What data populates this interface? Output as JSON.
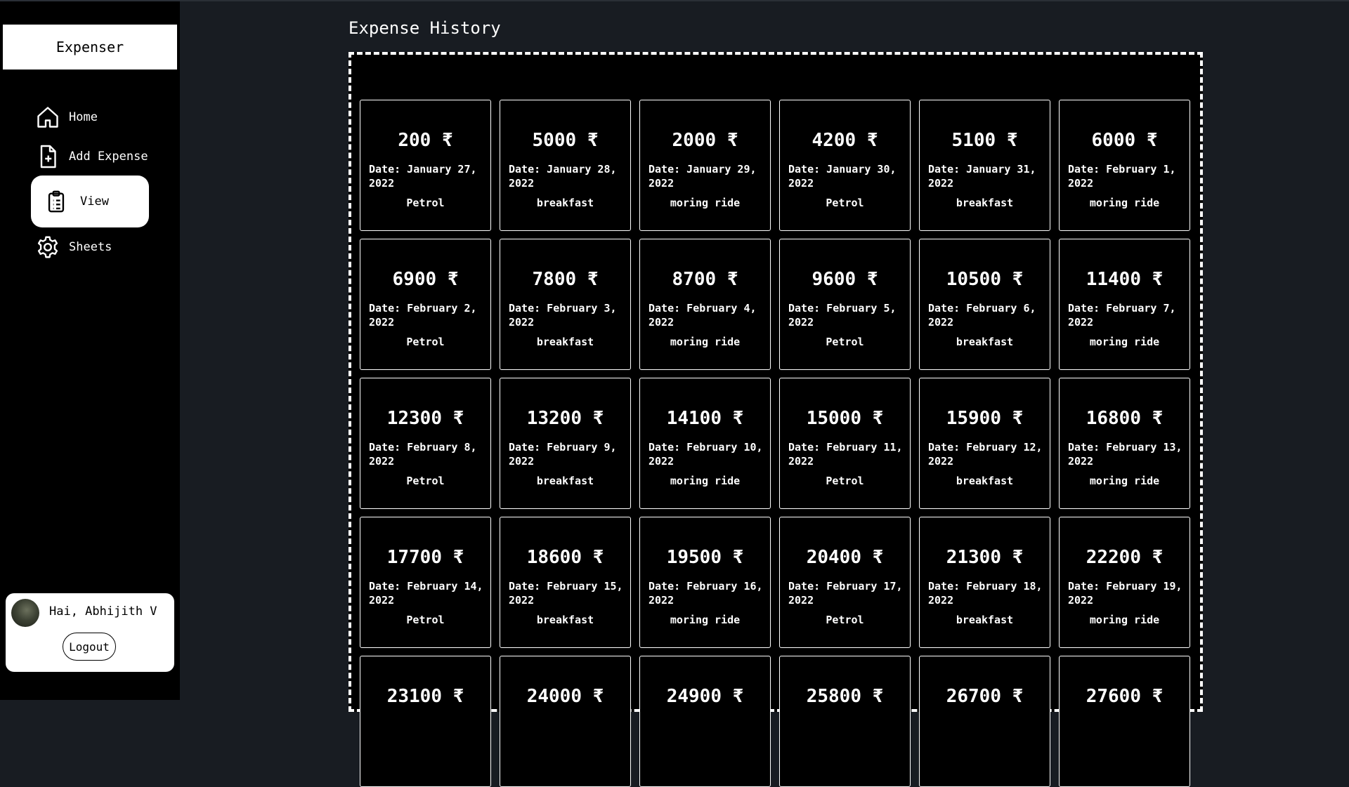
{
  "sidebar": {
    "brand": "Expenser",
    "items": [
      {
        "label": "Home",
        "icon": "home-icon"
      },
      {
        "label": "Add Expense",
        "icon": "add-file-icon"
      },
      {
        "label": "View",
        "icon": "clipboard-icon"
      },
      {
        "label": "Sheets",
        "icon": "gear-icon"
      }
    ],
    "active": "View",
    "user": {
      "greeting": "Hai, Abhijith V",
      "logout_label": "Logout"
    }
  },
  "main": {
    "title": "Expense History",
    "currency": "₹",
    "expenses": [
      {
        "amount": "200",
        "date": "Date: January 27, 2022",
        "desc": "Petrol"
      },
      {
        "amount": "5000",
        "date": "Date: January 28, 2022",
        "desc": "breakfast"
      },
      {
        "amount": "2000",
        "date": "Date: January 29, 2022",
        "desc": "moring ride"
      },
      {
        "amount": "4200",
        "date": "Date: January 30, 2022",
        "desc": "Petrol"
      },
      {
        "amount": "5100",
        "date": "Date: January 31, 2022",
        "desc": "breakfast"
      },
      {
        "amount": "6000",
        "date": "Date: February 1, 2022",
        "desc": "moring ride"
      },
      {
        "amount": "6900",
        "date": "Date: February 2, 2022",
        "desc": "Petrol"
      },
      {
        "amount": "7800",
        "date": "Date: February 3, 2022",
        "desc": "breakfast"
      },
      {
        "amount": "8700",
        "date": "Date: February 4, 2022",
        "desc": "moring ride"
      },
      {
        "amount": "9600",
        "date": "Date: February 5, 2022",
        "desc": "Petrol"
      },
      {
        "amount": "10500",
        "date": "Date: February 6, 2022",
        "desc": "breakfast"
      },
      {
        "amount": "11400",
        "date": "Date: February 7, 2022",
        "desc": "moring ride"
      },
      {
        "amount": "12300",
        "date": "Date: February 8, 2022",
        "desc": "Petrol"
      },
      {
        "amount": "13200",
        "date": "Date: February 9, 2022",
        "desc": "breakfast"
      },
      {
        "amount": "14100",
        "date": "Date: February 10, 2022",
        "desc": "moring ride"
      },
      {
        "amount": "15000",
        "date": "Date: February 11, 2022",
        "desc": "Petrol"
      },
      {
        "amount": "15900",
        "date": "Date: February 12, 2022",
        "desc": "breakfast"
      },
      {
        "amount": "16800",
        "date": "Date: February 13, 2022",
        "desc": "moring ride"
      },
      {
        "amount": "17700",
        "date": "Date: February 14, 2022",
        "desc": "Petrol"
      },
      {
        "amount": "18600",
        "date": "Date: February 15, 2022",
        "desc": "breakfast"
      },
      {
        "amount": "19500",
        "date": "Date: February 16, 2022",
        "desc": "moring ride"
      },
      {
        "amount": "20400",
        "date": "Date: February 17, 2022",
        "desc": "Petrol"
      },
      {
        "amount": "21300",
        "date": "Date: February 18, 2022",
        "desc": "breakfast"
      },
      {
        "amount": "22200",
        "date": "Date: February 19, 2022",
        "desc": "moring ride"
      },
      {
        "amount": "23100",
        "date": "",
        "desc": ""
      },
      {
        "amount": "24000",
        "date": "",
        "desc": ""
      },
      {
        "amount": "24900",
        "date": "",
        "desc": ""
      },
      {
        "amount": "25800",
        "date": "",
        "desc": ""
      },
      {
        "amount": "26700",
        "date": "",
        "desc": ""
      },
      {
        "amount": "27600",
        "date": "",
        "desc": ""
      }
    ]
  }
}
